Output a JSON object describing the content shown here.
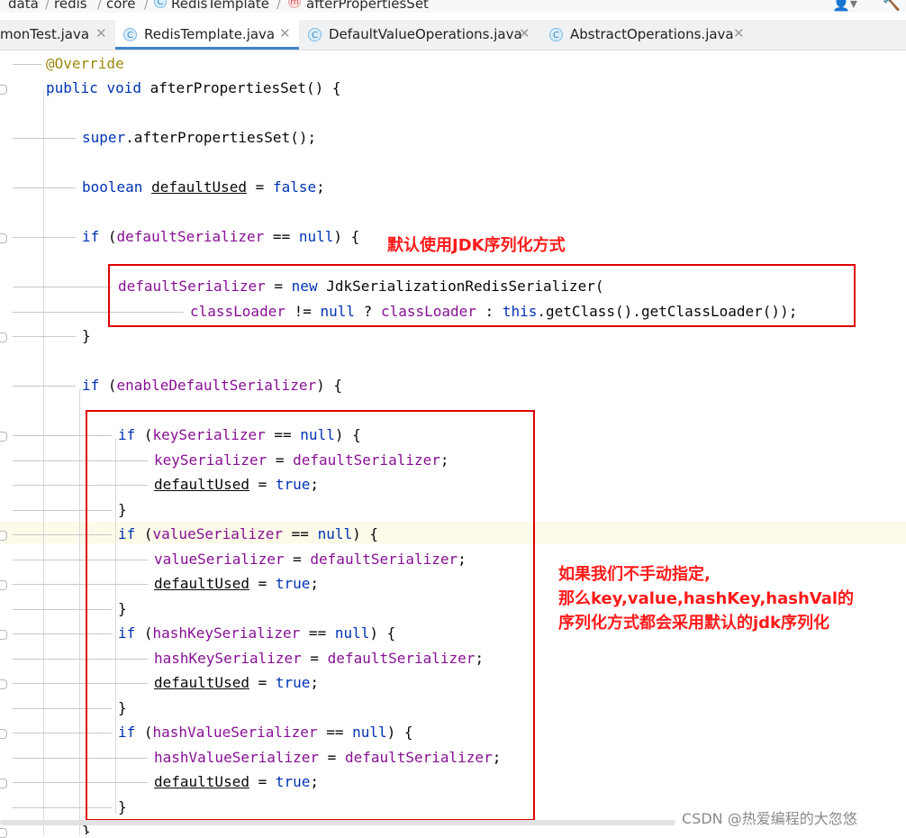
{
  "breadcrumb": {
    "items": [
      "data",
      "redis",
      "core",
      "RedisTemplate",
      "afterPropertiesSet"
    ],
    "icons": [
      "class-c-icon",
      "method-m-icon"
    ]
  },
  "tabs": [
    {
      "label": "monTest.java",
      "active": false
    },
    {
      "label": "RedisTemplate.java",
      "active": true
    },
    {
      "label": "DefaultValueOperations.java",
      "active": false
    },
    {
      "label": "AbstractOperations.java",
      "active": false
    }
  ],
  "code": {
    "annotation": "@Override",
    "kw_public": "public",
    "kw_void": "void",
    "kw_super": "super",
    "kw_boolean": "boolean",
    "kw_false": "false",
    "kw_if": "if",
    "kw_null": "null",
    "kw_new": "new",
    "kw_this": "this",
    "kw_true": "true",
    "method_name": " afterPropertiesSet() {",
    "super_call": ".afterPropertiesSet();",
    "defaultUsed": "defaultUsed",
    "assign_false": " = ",
    "semicolon": ";",
    "defaultSerializer": "defaultSerializer",
    "eq_null": " == ",
    "close_paren_brace": ") {",
    "jdk_ctor": " JdkSerializationRedisSerializer(",
    "classLoader": "classLoader",
    "neq": " != ",
    "ternary_q": " ? ",
    "ternary_c": " : ",
    "get_cl": ".getClass().getClassLoader());",
    "close_brace": "}",
    "enableDefaultSerializer": "enableDefaultSerializer",
    "keySerializer": "keySerializer",
    "valueSerializer": "valueSerializer",
    "hashKeySerializer": "hashKeySerializer",
    "hashValueSerializer": "hashValueSerializer",
    "open_paren": " (",
    "assign": " = "
  },
  "annotations": {
    "note1": "默认使用JDK序列化方式",
    "note2_lines": [
      "如果我们不手动指定,",
      "那么key,value,hashKey,hashVal的",
      "序列化方式都会采用默认的jdk序列化"
    ]
  },
  "colors": {
    "keyword": "#0033b3",
    "annotation": "#9e880d",
    "field": "#871094",
    "annotation_box": "#e00000",
    "note_text": "#ff1a1a"
  },
  "watermark": "CSDN @热爱编程的大忽悠"
}
